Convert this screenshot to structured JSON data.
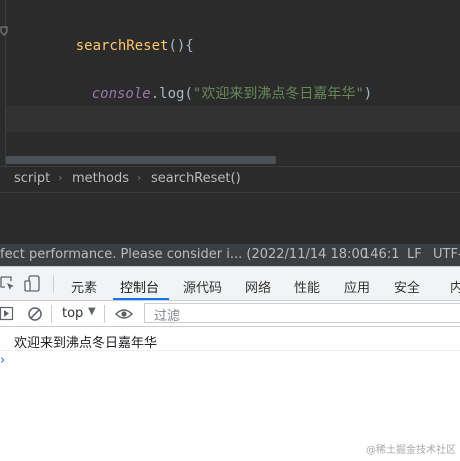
{
  "editor": {
    "function_name": "searchReset",
    "function_suffix": "(){",
    "console_obj": "console",
    "console_method": ".log(",
    "string_literal": "\"欢迎来到沸点冬日嘉年华\"",
    "close_paren": ")"
  },
  "breadcrumb": {
    "items": [
      "script",
      "methods",
      "searchReset()"
    ],
    "separator": "›"
  },
  "statusbar": {
    "message": "fect performance. Please consider i... (2022/11/14 18:00",
    "position": "146:1",
    "line_ending": "LF",
    "encoding": "UTF-"
  },
  "devtools": {
    "tabs": [
      "元素",
      "控制台",
      "源代码",
      "网络",
      "性能",
      "应用",
      "安全",
      "内"
    ],
    "active_tab": "控制台",
    "context": "top",
    "filter_placeholder": "过滤"
  },
  "console": {
    "output": "欢迎来到沸点冬日嘉年华",
    "prompt": "›"
  },
  "watermark": "@稀土掘金技术社区",
  "colors": {
    "editor_bg": "#2b2b2b",
    "function": "#ffc66d",
    "keyword_italic": "#9876aa",
    "string": "#6a8759",
    "active_tab_underline": "#1a73e8"
  }
}
